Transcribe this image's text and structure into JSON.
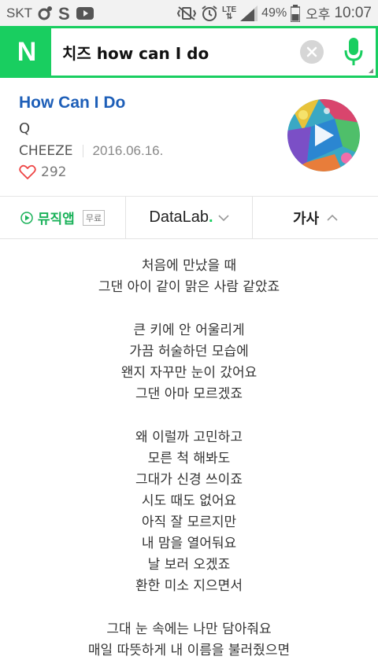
{
  "status_bar": {
    "carrier": "SKT",
    "network": "LTE",
    "battery": "49%",
    "ampm": "오후",
    "time": "10:07"
  },
  "search": {
    "query": "치즈 how can I do",
    "logo": "N"
  },
  "song": {
    "title": "How Can I Do",
    "album": "Q",
    "artist": "CHEEZE",
    "date": "2016.06.16.",
    "likes": "292"
  },
  "tabs": {
    "music_app": "뮤직앱",
    "free_badge": "무료",
    "datalab": "DataLab",
    "datalab_dot": ".",
    "lyrics": "가사"
  },
  "lyrics": [
    [
      "처음에 만났을 때",
      "그댄 아이 같이 맑은 사람 같았죠"
    ],
    [
      "큰 키에 안 어울리게",
      "가끔 허술하던 모습에",
      "왠지 자꾸만 눈이 갔어요",
      "그댄 아마 모르겠죠"
    ],
    [
      "왜 이럴까 고민하고",
      "모른 척 해봐도",
      "그대가 신경 쓰이죠",
      "시도 때도 없어요",
      "아직 잘 모르지만",
      "내 맘을 열어둬요",
      "날 보러 오겠죠",
      "환한 미소 지으면서"
    ],
    [
      "그대 눈 속에는 나만 담아줘요",
      "매일 따뜻하게 내 이름을 불러줬으면"
    ]
  ],
  "colors": {
    "naver_green": "#19ce60",
    "title_blue": "#1e5fb8"
  },
  "icons": {
    "mic": "microphone-icon",
    "clear": "clear-icon",
    "heart": "heart-icon",
    "play": "play-icon"
  }
}
